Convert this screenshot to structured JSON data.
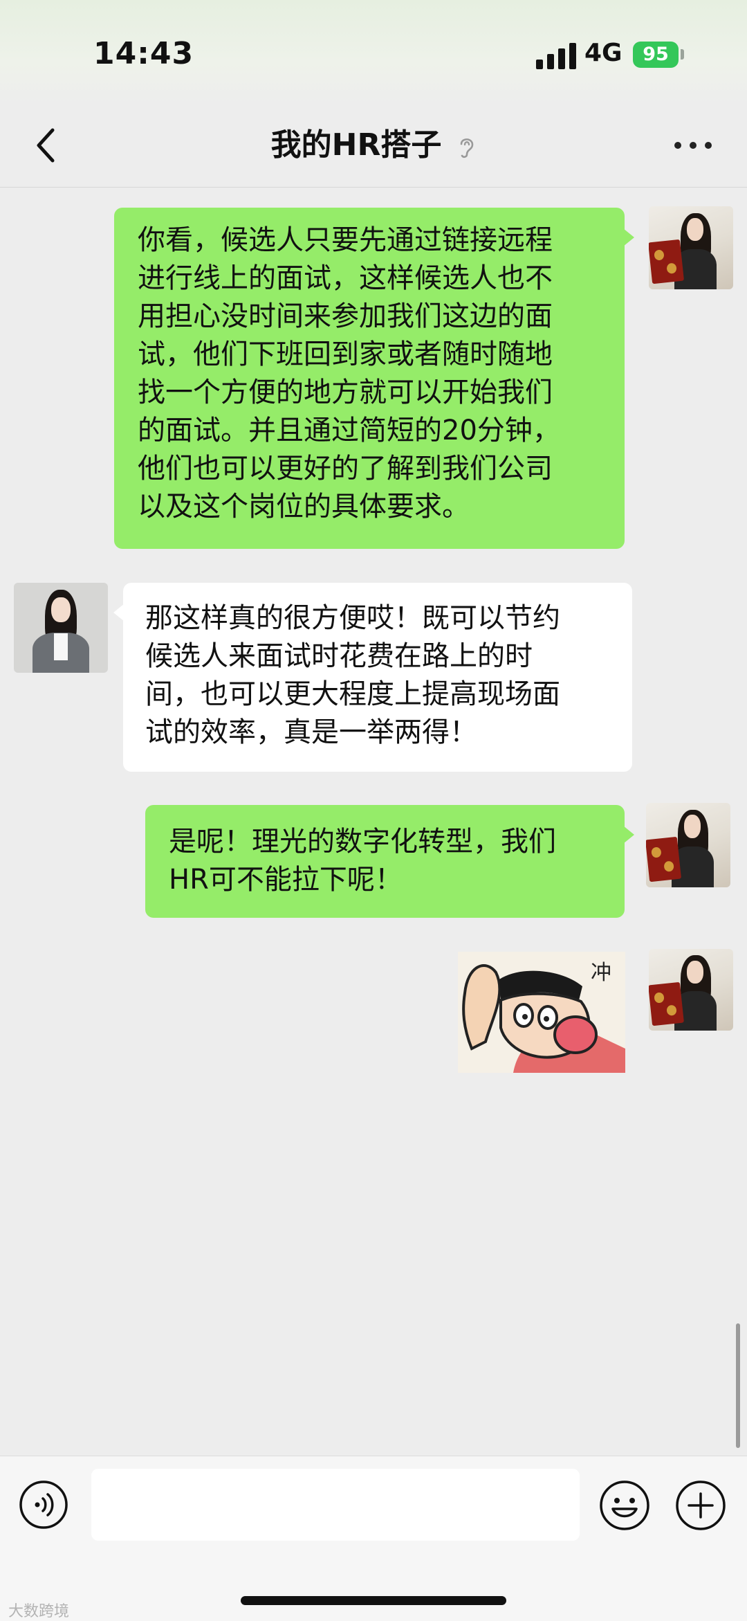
{
  "status": {
    "time": "14:43",
    "network": "4G",
    "battery": "95"
  },
  "nav": {
    "title": "我的HR搭子"
  },
  "messages": [
    {
      "from": "me",
      "lines": [
        "你看，候选人只要先通过链接远程",
        "进行线上的面试，这样候选人也不",
        "用担心没时间来参加我们这边的面",
        "试，他们下班回到家或者随时随地",
        "找一个方便的地方就可以开始我们",
        "的面试。并且通过简短的20分钟，",
        "他们也可以更好的了解到我们公司",
        "以及这个岗位的具体要求。"
      ]
    },
    {
      "from": "her",
      "lines": [
        "那这样真的很方便哎！既可以节约",
        "候选人来面试时花费在路上的时",
        "间，也可以更大程度上提高现场面",
        "试的效率，真是一举两得！"
      ]
    },
    {
      "from": "me",
      "lines": [
        "是呢！理光的数字化转型，我们",
        "HR可不能拉下呢！"
      ]
    },
    {
      "from": "me",
      "type": "sticker",
      "caption": "冲"
    }
  ],
  "watermark": "大数跨境",
  "icons": [
    "back-arrow-icon",
    "ear-icon",
    "more-icon",
    "voice-icon",
    "emoji-icon",
    "plus-icon"
  ],
  "colors": {
    "out_bubble": "#95ec69",
    "in_bubble": "#ffffff",
    "background": "#ededed",
    "battery": "#34c759"
  }
}
